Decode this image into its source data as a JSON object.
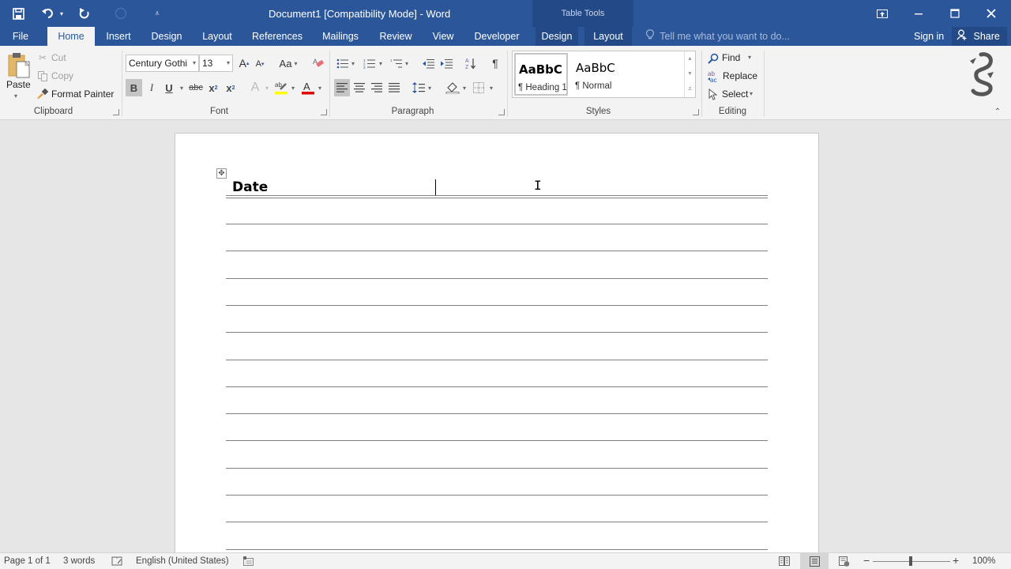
{
  "window": {
    "title": "Document1 [Compatibility Mode] - Word",
    "contextual_group": "Table Tools",
    "controls": [
      "ribbon-display-options",
      "minimize",
      "maximize",
      "close"
    ]
  },
  "qat": {
    "save_icon": "save-icon",
    "undo_icon": "undo-icon",
    "redo_icon": "redo-icon",
    "touch_icon": "touch-mode-icon",
    "customize_icon": "customize-qat-icon"
  },
  "tabs": [
    {
      "label": "File",
      "active": false
    },
    {
      "label": "Home",
      "active": true
    },
    {
      "label": "Insert",
      "active": false
    },
    {
      "label": "Design",
      "active": false
    },
    {
      "label": "Layout",
      "active": false
    },
    {
      "label": "References",
      "active": false
    },
    {
      "label": "Mailings",
      "active": false
    },
    {
      "label": "Review",
      "active": false
    },
    {
      "label": "View",
      "active": false
    },
    {
      "label": "Developer",
      "active": false
    },
    {
      "label": "Design",
      "active": false,
      "contextual": true
    },
    {
      "label": "Layout",
      "active": false,
      "contextual": true
    }
  ],
  "tell_me": {
    "placeholder": "Tell me what you want to do..."
  },
  "account": {
    "sign_in": "Sign in",
    "share": "Share"
  },
  "ribbon": {
    "clipboard": {
      "label": "Clipboard",
      "paste": "Paste",
      "cut": "Cut",
      "copy": "Copy",
      "format_painter": "Format Painter"
    },
    "font": {
      "label": "Font",
      "font_name": "Century Gothi",
      "font_size": "13",
      "bold_active": true,
      "change_case": "Aa",
      "highlight_color": "#ffff00",
      "font_color": "#e00000"
    },
    "paragraph": {
      "label": "Paragraph",
      "align_left_active": true
    },
    "styles": {
      "label": "Styles",
      "items": [
        {
          "sample": "AaBbC",
          "name": "¶ Heading 1",
          "selected": true
        },
        {
          "sample": "AaBbC",
          "name": "¶ Normal",
          "selected": false
        }
      ]
    },
    "editing": {
      "label": "Editing",
      "find": "Find",
      "replace": "Replace",
      "select": "Select"
    }
  },
  "document": {
    "heading": "Date",
    "ruled_lines": 13
  },
  "status": {
    "page": "Page 1 of 1",
    "words": "3 words",
    "language": "English (United States)",
    "zoom": "100%",
    "zoom_level_percent": 100,
    "active_view": "print-layout"
  },
  "colors": {
    "brand": "#2b579a",
    "contextual": "#234a86",
    "ribbon_bg": "#f3f3f3",
    "canvas_bg": "#e6e6e6"
  }
}
